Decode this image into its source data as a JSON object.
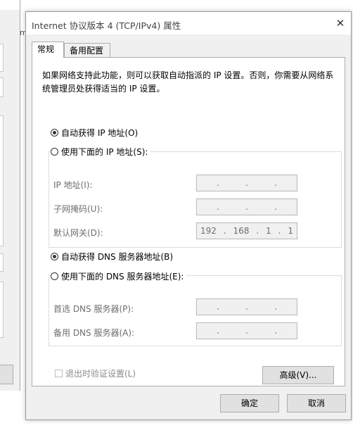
{
  "background_window": {
    "partial_text": "m"
  },
  "dialog": {
    "title": "Internet 协议版本 4 (TCP/IPv4) 属性",
    "close_glyph": "✕",
    "tabs": [
      {
        "label": "常规",
        "active": true
      },
      {
        "label": "备用配置",
        "active": false
      }
    ],
    "description": "如果网络支持此功能，则可以获取自动指派的 IP 设置。否则，你需要从网络系统管理员处获得适当的 IP 设置。",
    "ip": {
      "auto_label": "自动获得 IP 地址(O)",
      "auto_selected": true,
      "manual_label": "使用下面的 IP 地址(S):",
      "fields": [
        {
          "label": "IP 地址(I):",
          "octets": [
            "",
            "",
            "",
            ""
          ]
        },
        {
          "label": "子网掩码(U):",
          "octets": [
            "",
            "",
            "",
            ""
          ]
        },
        {
          "label": "默认网关(D):",
          "octets": [
            "192",
            "168",
            "1",
            "1"
          ]
        }
      ]
    },
    "dns": {
      "auto_label": "自动获得 DNS 服务器地址(B)",
      "auto_selected": true,
      "manual_label": "使用下面的 DNS 服务器地址(E):",
      "fields": [
        {
          "label": "首选 DNS 服务器(P):",
          "octets": [
            "",
            "",
            "",
            ""
          ]
        },
        {
          "label": "备用 DNS 服务器(A):",
          "octets": [
            "",
            "",
            "",
            ""
          ]
        }
      ]
    },
    "validate_label": "退出时验证设置(L)",
    "advanced_button": "高级(V)...",
    "ok_button": "确定",
    "cancel_button": "取消",
    "ip_separator": "."
  }
}
